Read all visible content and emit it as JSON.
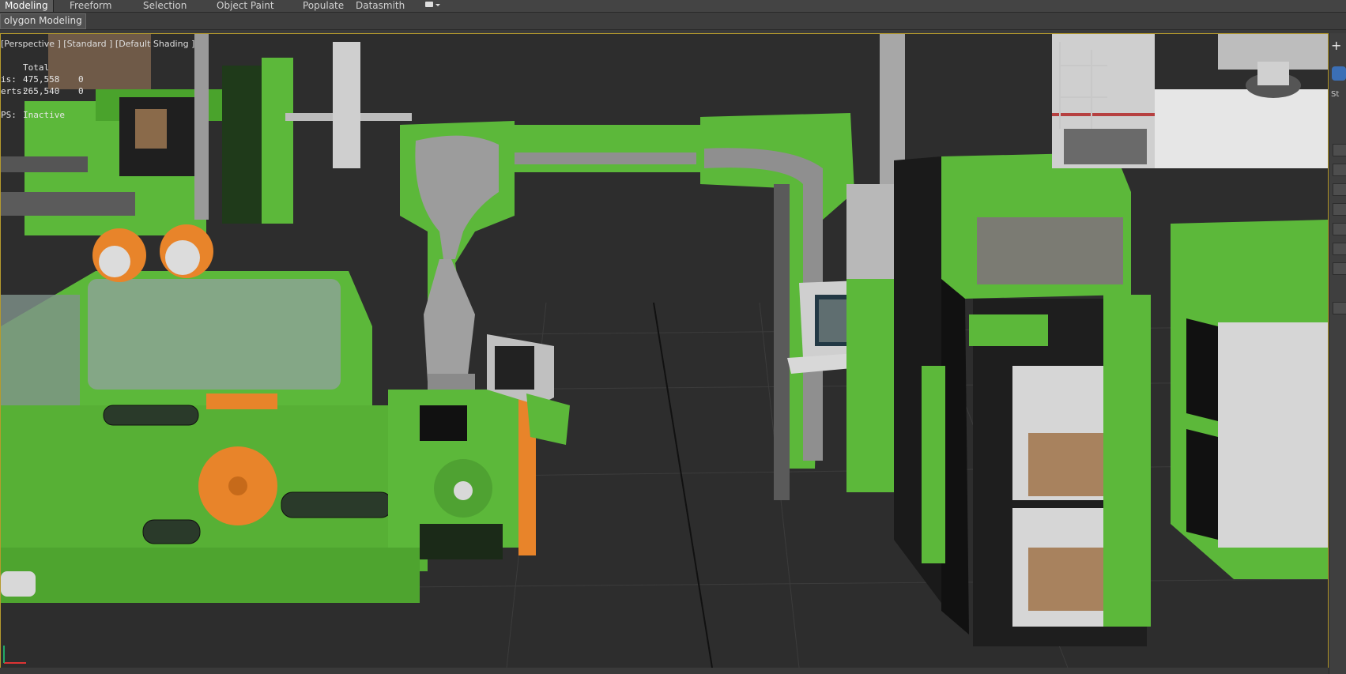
{
  "ribbon": {
    "tabs": [
      {
        "label": "Modeling",
        "active": true
      },
      {
        "label": "Freeform",
        "active": false
      },
      {
        "label": "Selection",
        "active": false
      },
      {
        "label": "Object Paint",
        "active": false
      },
      {
        "label": "Populate",
        "active": false
      },
      {
        "label": "Datasmith",
        "active": false
      }
    ],
    "sub_tab": "olygon Modeling"
  },
  "viewport": {
    "label": "[Perspective ] [Standard ] [Default Shading ]",
    "stats": {
      "header": "Total",
      "rows": [
        {
          "label": "is:",
          "total": "475,558",
          "selected": "0"
        },
        {
          "label": "erts:",
          "total": "265,540",
          "selected": "0"
        }
      ],
      "fps_label": "PS:",
      "fps_value": "Inactive"
    }
  },
  "right_panel": {
    "labels": [
      "St"
    ]
  },
  "colors": {
    "machine_green": "#5cb83a",
    "dark_green": "#3e8a27",
    "floor": "#2e2e2e",
    "orange": "#e8842a",
    "viewport_border": "#b59a2d"
  },
  "icons": [
    "dropdown-icon",
    "view-gizmo-icon",
    "axis-tripod-icon"
  ]
}
